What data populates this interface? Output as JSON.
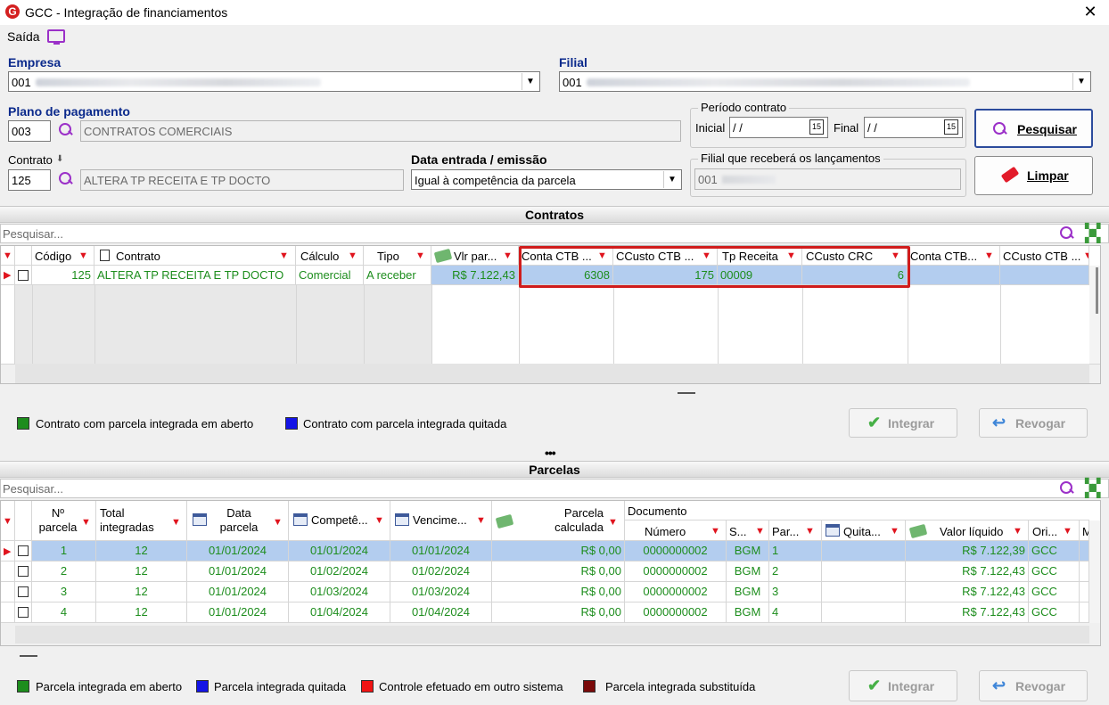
{
  "window": {
    "title": "GCC - Integração de financiamentos",
    "logo_letter": "G",
    "close": "✕"
  },
  "menu": {
    "saida": "Saída"
  },
  "empresa": {
    "label": "Empresa",
    "value": "001"
  },
  "filial": {
    "label": "Filial",
    "value": "001"
  },
  "plano": {
    "label": "Plano de pagamento",
    "code": "003",
    "desc": "CONTRATOS COMERCIAIS"
  },
  "periodo": {
    "legend": "Período contrato",
    "inicial_label": "Inicial",
    "inicial_value": " / /",
    "final_label": "Final",
    "final_value": " / /",
    "cal_badge": "15"
  },
  "contrato": {
    "label": "Contrato",
    "code": "125",
    "desc": "ALTERA TP RECEITA E TP DOCTO"
  },
  "data_entrada": {
    "label": "Data entrada / emissão",
    "value": "Igual à competência da parcela"
  },
  "filial_receb": {
    "legend": "Filial que receberá os lançamentos",
    "value": "001"
  },
  "buttons": {
    "pesquisar": "Pesquisar",
    "limpar": "Limpar",
    "integrar": "Integrar",
    "revogar": "Revogar"
  },
  "contratos_section": {
    "title": "Contratos",
    "search_placeholder": "Pesquisar...",
    "columns": [
      "Código",
      "Contrato",
      "Cálculo",
      "Tipo",
      "Vlr par...",
      "Conta CTB ...",
      "CCusto CTB ...",
      "Tp Receita",
      "CCusto CRC",
      "Conta CTB...",
      "CCusto CTB ..."
    ],
    "row": {
      "codigo": "125",
      "contrato": "ALTERA TP RECEITA E TP DOCTO",
      "calculo": "Comercial",
      "tipo": "A receber",
      "vlr": "R$ 7.122,43",
      "conta_ctb": "6308",
      "ccusto_ctb": "175",
      "tp_receita": "00009",
      "ccusto_crc": "6"
    },
    "legend1": "Contrato com parcela integrada em aberto",
    "legend2": "Contrato com parcela integrada quitada"
  },
  "parcelas_section": {
    "title": "Parcelas",
    "search_placeholder": "Pesquisar...",
    "cols": {
      "num": "Nº\nparcela",
      "total": "Total\nintegradas",
      "data": "Data\nparcela",
      "compet": "Competê...",
      "venc": "Vencime...",
      "calc": "Parcela\ncalculada",
      "documento": "Documento",
      "numero": "Número",
      "s": "S...",
      "par": "Par...",
      "quita": "Quita...",
      "valor": "Valor líquido",
      "ori": "Ori...",
      "m": "M"
    },
    "rows": [
      {
        "num": "1",
        "total": "12",
        "data": "01/01/2024",
        "compet": "01/01/2024",
        "venc": "01/01/2024",
        "calc": "R$ 0,00",
        "numero": "0000000002",
        "s": "BGM",
        "par": "1",
        "valor": "R$ 7.122,39",
        "ori": "GCC"
      },
      {
        "num": "2",
        "total": "12",
        "data": "01/01/2024",
        "compet": "01/02/2024",
        "venc": "01/02/2024",
        "calc": "R$ 0,00",
        "numero": "0000000002",
        "s": "BGM",
        "par": "2",
        "valor": "R$ 7.122,43",
        "ori": "GCC"
      },
      {
        "num": "3",
        "total": "12",
        "data": "01/01/2024",
        "compet": "01/03/2024",
        "venc": "01/03/2024",
        "calc": "R$ 0,00",
        "numero": "0000000002",
        "s": "BGM",
        "par": "3",
        "valor": "R$ 7.122,43",
        "ori": "GCC"
      },
      {
        "num": "4",
        "total": "12",
        "data": "01/01/2024",
        "compet": "01/04/2024",
        "venc": "01/04/2024",
        "calc": "R$ 0,00",
        "numero": "0000000002",
        "s": "BGM",
        "par": "4",
        "valor": "R$ 7.122,43",
        "ori": "GCC"
      }
    ],
    "legends": [
      "Parcela integrada em aberto",
      "Parcela integrada quitada",
      "Controle efetuado em outro sistema",
      "Parcela integrada substituída"
    ]
  },
  "splitter": "•••",
  "colors": {
    "green": "#1d8d1d",
    "blue": "#1414e6",
    "red": "#f01414",
    "darkred": "#7a0a0a",
    "accent": "#9b30c8",
    "highlight": "#d01c1c"
  }
}
